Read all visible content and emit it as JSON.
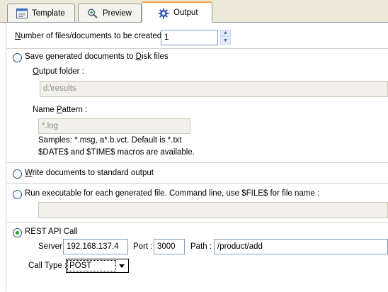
{
  "tabs": [
    {
      "label": "Template",
      "icon": "form-icon",
      "active": false
    },
    {
      "label": "Preview",
      "icon": "magnifier-icon",
      "active": false
    },
    {
      "label": "Output",
      "icon": "gear-icon",
      "active": true
    }
  ],
  "count": {
    "label_mnemonic": "N",
    "label_rest": "umber of files/documents to be created :",
    "value": "1",
    "spin_up": "▲",
    "spin_down": "▼"
  },
  "disk": {
    "label_pre": "Save generated documents to ",
    "label_mnemonic": "D",
    "label_post": "isk files",
    "folder_label_mnemonic": "O",
    "folder_label_rest": "utput folder :",
    "folder_value": "d:\\results",
    "pattern_label_pre": "Name ",
    "pattern_label_mnemonic": "P",
    "pattern_label_post": "attern :",
    "pattern_value": "*.log",
    "hint1": "Samples: *.msg, a*.b.vct. Default is *.txt",
    "hint2": "$DATE$ and $TIME$ macros are available."
  },
  "stdout": {
    "label_mnemonic": "W",
    "label_rest": "rite documents to standard output"
  },
  "exec": {
    "label": "Run executable for each generated file. Command line, use $FILE$ for file name :",
    "value": ""
  },
  "rest": {
    "label": "REST API Call",
    "server_label": "Server :",
    "server_value": "192.168.137.4",
    "port_label": "Port :",
    "port_value": "3000",
    "path_label": "Path :",
    "path_value": "/product/add",
    "calltype_label": "Call Type :",
    "calltype_value": "POST",
    "selected": true
  }
}
